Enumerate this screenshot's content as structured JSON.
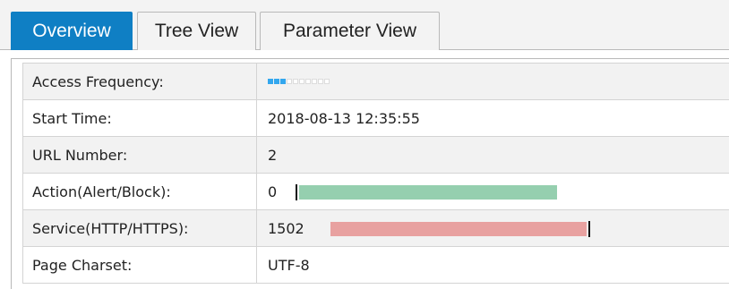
{
  "tabs": [
    {
      "label": "Overview",
      "active": true
    },
    {
      "label": "Tree View",
      "active": false
    },
    {
      "label": "Parameter View",
      "active": false
    }
  ],
  "rows": {
    "access_frequency": {
      "label": "Access Frequency:",
      "meter_level": 3,
      "meter_max": 10
    },
    "start_time": {
      "label": "Start Time:",
      "value": "2018-08-13 12:35:55"
    },
    "url_number": {
      "label": "URL Number:",
      "value": "2"
    },
    "action": {
      "label": "Action(Alert/Block):",
      "value": "0",
      "ratio": 0,
      "bar_color": "#95cfaf"
    },
    "service": {
      "label": "Service(HTTP/HTTPS):",
      "value": "1502",
      "ratio": 1,
      "bar_color": "#e8a1a0"
    },
    "page_charset": {
      "label": "Page Charset:",
      "value": "UTF-8"
    }
  },
  "colors": {
    "tab_active_bg": "#0f7fc4",
    "meter_on": "#33a7ee"
  }
}
